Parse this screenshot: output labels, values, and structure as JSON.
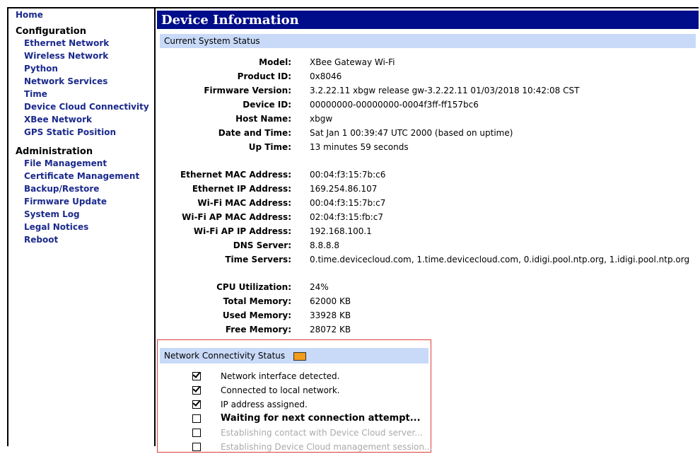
{
  "sidebar": {
    "home": "Home",
    "configuration": {
      "title": "Configuration",
      "items": [
        "Ethernet Network",
        "Wireless Network",
        "Python",
        "Network Services",
        "Time",
        "Device Cloud Connectivity",
        "XBee Network",
        "GPS Static Position"
      ]
    },
    "administration": {
      "title": "Administration",
      "items": [
        "File Management",
        "Certificate Management",
        "Backup/Restore",
        "Firmware Update",
        "System Log",
        "Legal Notices",
        "Reboot"
      ]
    }
  },
  "main": {
    "title": "Device Information",
    "status_section": "Current System Status",
    "fields": {
      "model": {
        "label": "Model:",
        "value": "XBee Gateway Wi-Fi"
      },
      "product_id": {
        "label": "Product ID:",
        "value": "0x8046"
      },
      "firmware": {
        "label": "Firmware Version:",
        "value": "3.2.22.11  xbgw release gw-3.2.22.11 01/03/2018 10:42:08 CST"
      },
      "device_id": {
        "label": "Device ID:",
        "value": "00000000-00000000-0004f3ff-ff157bc6"
      },
      "host_name": {
        "label": "Host Name:",
        "value": "xbgw"
      },
      "date_time": {
        "label": "Date and Time:",
        "value": "Sat Jan 1 00:39:47 UTC 2000 (based on uptime)"
      },
      "up_time": {
        "label": "Up Time:",
        "value": "13 minutes 59 seconds"
      },
      "eth_mac": {
        "label": "Ethernet MAC Address:",
        "value": "00:04:f3:15:7b:c6"
      },
      "eth_ip": {
        "label": "Ethernet IP Address:",
        "value": "169.254.86.107"
      },
      "wifi_mac": {
        "label": "Wi-Fi MAC Address:",
        "value": "00:04:f3:15:7b:c7"
      },
      "wifi_ap_mac": {
        "label": "Wi-Fi AP MAC Address:",
        "value": "02:04:f3:15:fb:c7"
      },
      "wifi_ap_ip": {
        "label": "Wi-Fi AP IP Address:",
        "value": "192.168.100.1"
      },
      "dns": {
        "label": "DNS Server:",
        "value": "8.8.8.8"
      },
      "time_servers": {
        "label": "Time Servers:",
        "value": "0.time.devicecloud.com, 1.time.devicecloud.com, 0.idigi.pool.ntp.org, 1.idigi.pool.ntp.org"
      },
      "cpu": {
        "label": "CPU Utilization:",
        "value": "24%"
      },
      "total_mem": {
        "label": "Total Memory:",
        "value": "62000 KB"
      },
      "used_mem": {
        "label": "Used Memory:",
        "value": "33928 KB"
      },
      "free_mem": {
        "label": "Free Memory:",
        "value": "28072 KB"
      }
    },
    "network": {
      "title": "Network Connectivity Status",
      "indicator_color": "#f39b1a",
      "checks": [
        {
          "label": "Network interface detected.",
          "checked": true
        },
        {
          "label": "Connected to local network.",
          "checked": true
        },
        {
          "label": "IP address assigned.",
          "checked": true
        },
        {
          "label": "Waiting for next connection attempt...",
          "checked": false
        },
        {
          "label": "Establishing contact with Device Cloud server...",
          "checked": false
        },
        {
          "label": "Establishing Device Cloud management session...",
          "checked": false
        }
      ]
    }
  }
}
